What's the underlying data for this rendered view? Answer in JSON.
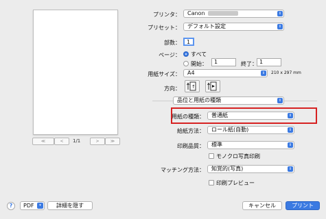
{
  "preview": {
    "page_indicator": "1/1",
    "nav_first": "≪",
    "nav_prev": "<",
    "nav_next": ">",
    "nav_last": "≫"
  },
  "printer": {
    "label": "プリンタ：",
    "value": "Canon"
  },
  "preset": {
    "label": "プリセット：",
    "value": "デフォルト設定"
  },
  "copies": {
    "label": "部数：",
    "value": "1"
  },
  "pages": {
    "label": "ページ：",
    "all_label": "すべて",
    "from_label": "開始：",
    "from_value": "1",
    "to_label": "終了：",
    "to_value": "1"
  },
  "paper_size": {
    "label": "用紙サイズ：",
    "value": "A4",
    "dimensions": "210 x 297 mm"
  },
  "orientation": {
    "label": "方向："
  },
  "section": {
    "value": "品位と用紙の種類"
  },
  "media_type": {
    "label": "用紙の種類：",
    "value": "普通紙"
  },
  "paper_source": {
    "label": "給紙方法：",
    "value": "ロール紙(自動)"
  },
  "print_quality": {
    "label": "印刷品質：",
    "value": "標準"
  },
  "grayscale": {
    "label": "モノクロ写真印刷"
  },
  "matching": {
    "label": "マッチング方法：",
    "value": "知覚的(写真)"
  },
  "print_preview": {
    "label": "印刷プレビュー"
  },
  "footer": {
    "help": "?",
    "pdf": "PDF",
    "hide_details": "詳細を隠す",
    "cancel": "キャンセル",
    "print": "プリント"
  },
  "colors": {
    "accent": "#3b7ae2",
    "highlight": "#d62020"
  }
}
